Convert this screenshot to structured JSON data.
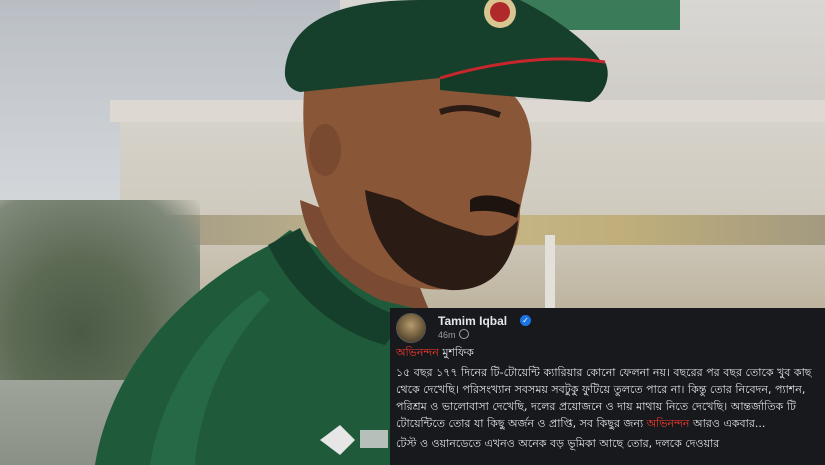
{
  "post": {
    "author": "Tamim Iqbal",
    "verified_mark": "✓",
    "time": "46m",
    "heading_highlight": "অভিনন্দন",
    "heading_rest": " মুশফিক",
    "para1_a": "১৫ বছর ১৭৭ দিনের টি-টোয়েন্টি ক্যারিয়ার কোনো ফেলনা নয়। বছরের পর বছর তোকে খুব কাছ থেকে দেখেছি। পরিসংখ্যান সবসময় সবটুকু ফুটিয়ে তুলতে পারে না। কিন্তু তোর নিবেদন, প্যাশন, পরিশ্রম ও ভালোবাসা দেখেছি, দলের প্রয়োজনে ও দায় মাথায় নিতে দেখেছি। আন্তর্জাতিক টি টোয়েন্টিতে তোর যা কিছু অর্জন ও প্রাপ্তি, সব কিছুর জন্য ",
    "para1_highlight": "অভিনন্দন",
    "para1_b": " আরও একবার...",
    "para2": "টেস্ট ও ওয়ানডেতে এখনও অনেক বড় ভূমিকা আছে তোর, দলকে দেওয়ার"
  },
  "icons": {
    "avatar": "profile-avatar",
    "verified": "verified-badge-icon",
    "audience": "globe-icon"
  },
  "colors": {
    "highlight": "#ff3b30",
    "post_bg": "#17191c",
    "verified": "#1b74e4",
    "jersey": "#1f5a3b",
    "cap": "#17402c"
  }
}
